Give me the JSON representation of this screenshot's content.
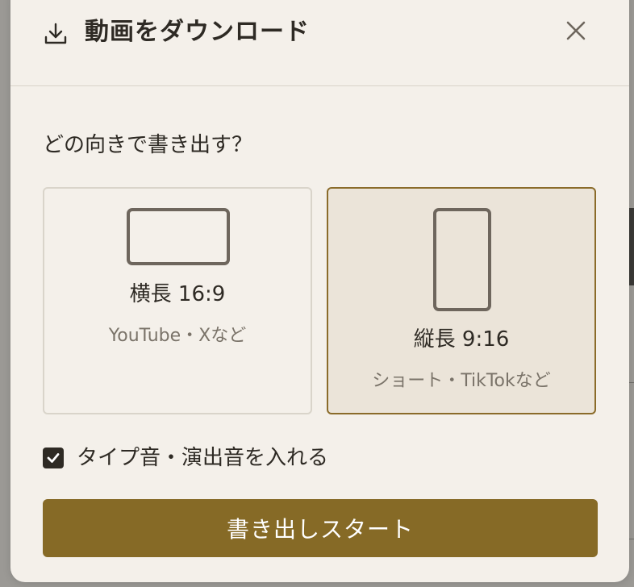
{
  "dialog": {
    "title": "動画をダウンロード",
    "question": "どの向きで書き出す？",
    "options": [
      {
        "label": "横長 16:9",
        "sub": "YouTube・Xなど",
        "selected": false
      },
      {
        "label": "縦長 9:16",
        "sub": "ショート・TikTokなど",
        "selected": true
      }
    ],
    "checkbox": {
      "label": "タイプ音・演出音を入れる",
      "checked": true
    },
    "start_button": "書き出しスタート"
  },
  "icons": {
    "download": "download-icon",
    "close": "close-icon",
    "check": "check-icon"
  },
  "colors": {
    "accent": "#866a26",
    "selected_border": "#8a6b2a",
    "selected_bg": "#ebe4d9",
    "modal_bg": "#f4f0ea",
    "text": "#2e2a24",
    "muted": "#7a7369"
  }
}
